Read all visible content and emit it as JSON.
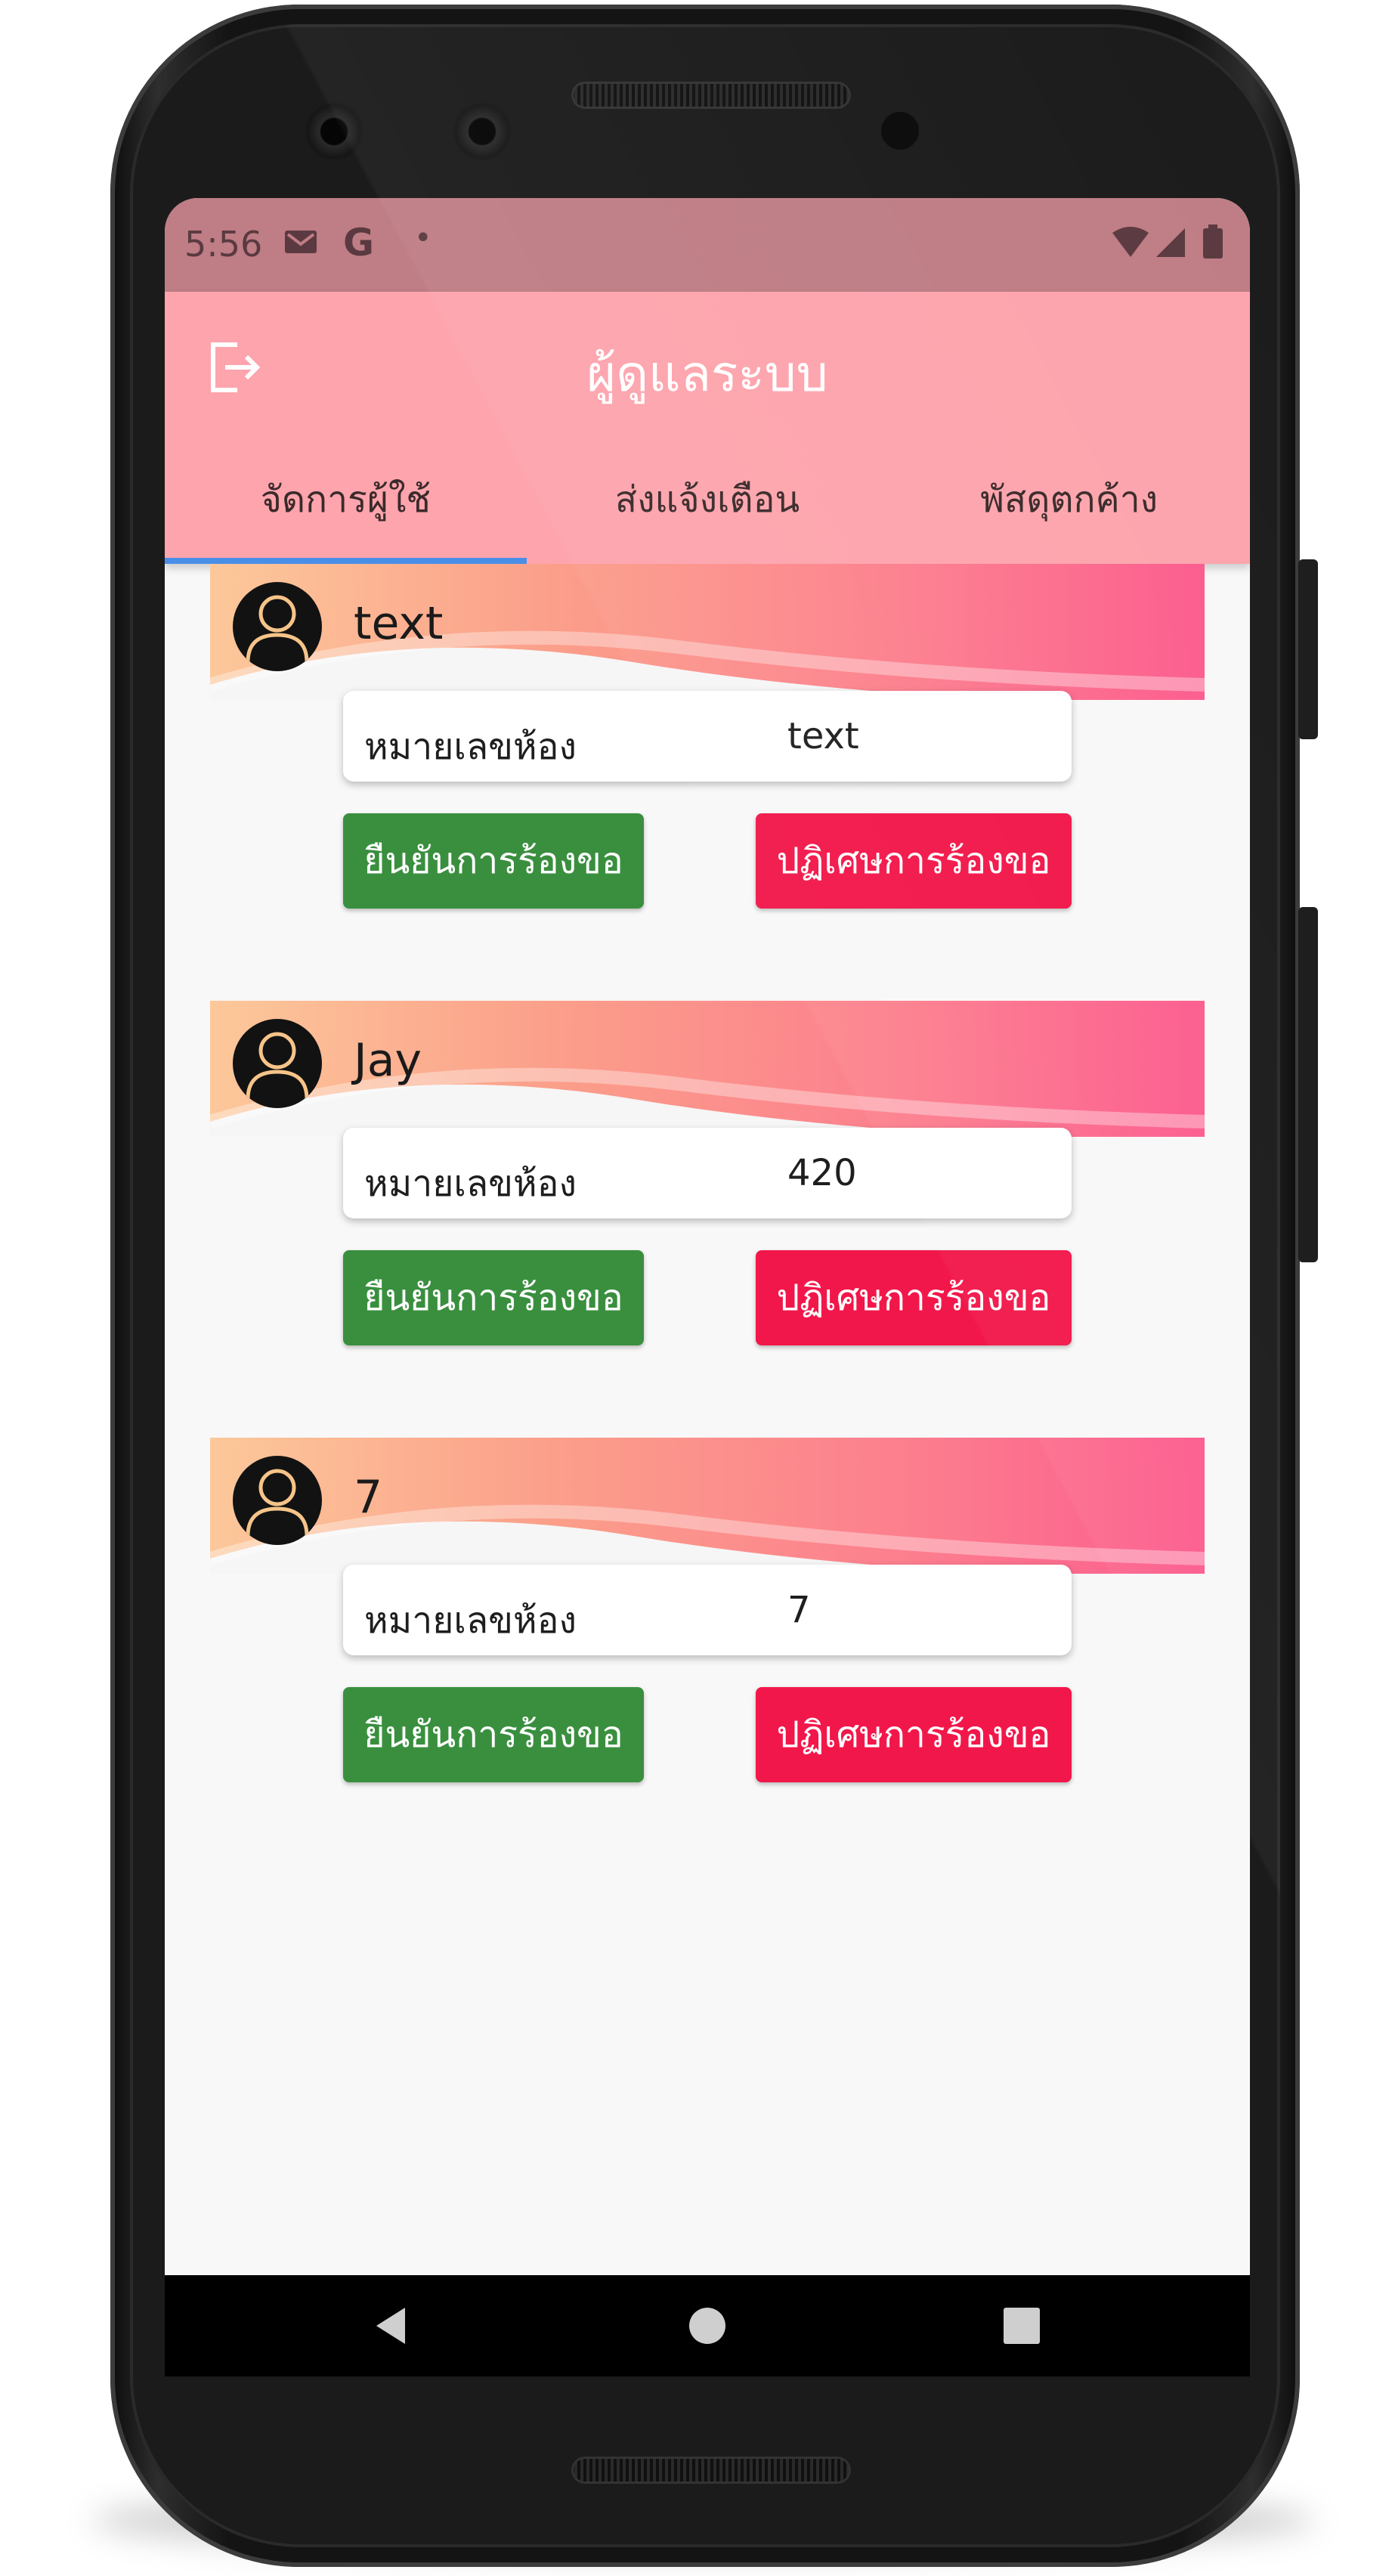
{
  "status_bar": {
    "time": "5:56",
    "icons": [
      "gmail-icon",
      "google-icon",
      "notification-dot-icon",
      "wifi-icon",
      "signal-icon",
      "battery-icon"
    ],
    "g_letter": "G",
    "dot": "•"
  },
  "app_bar": {
    "title": "ผู้ดูแลระบบ",
    "logout_icon": "logout-icon",
    "background_color": "#fda4ad"
  },
  "tabs": [
    {
      "label": "จัดการผู้ใช้",
      "active": true
    },
    {
      "label": "ส่งแจ้งเตือน",
      "active": false
    },
    {
      "label": "พัสดุตกค้าง",
      "active": false
    }
  ],
  "requests": [
    {
      "name": "text",
      "room_label": "หมายเลขห้อง",
      "room": "text",
      "confirm_label": "ยืนยันการร้องขอ",
      "reject_label": "ปฏิเศษการร้องขอ"
    },
    {
      "name": "Jay",
      "room_label": "หมายเลขห้อง",
      "room": "420",
      "confirm_label": "ยืนยันการร้องขอ",
      "reject_label": "ปฏิเศษการร้องขอ"
    },
    {
      "name": "7",
      "room_label": "หมายเลขห้อง",
      "room": "7",
      "confirm_label": "ยืนยันการร้องขอ",
      "reject_label": "ปฏิเศษการร้องขอ"
    }
  ],
  "colors": {
    "confirm": "#3a8f3f",
    "reject": "#f2174a",
    "tab_indicator": "#4a8fe7"
  },
  "nav_bar": {
    "buttons": [
      "back-icon",
      "home-icon",
      "recents-icon"
    ]
  }
}
